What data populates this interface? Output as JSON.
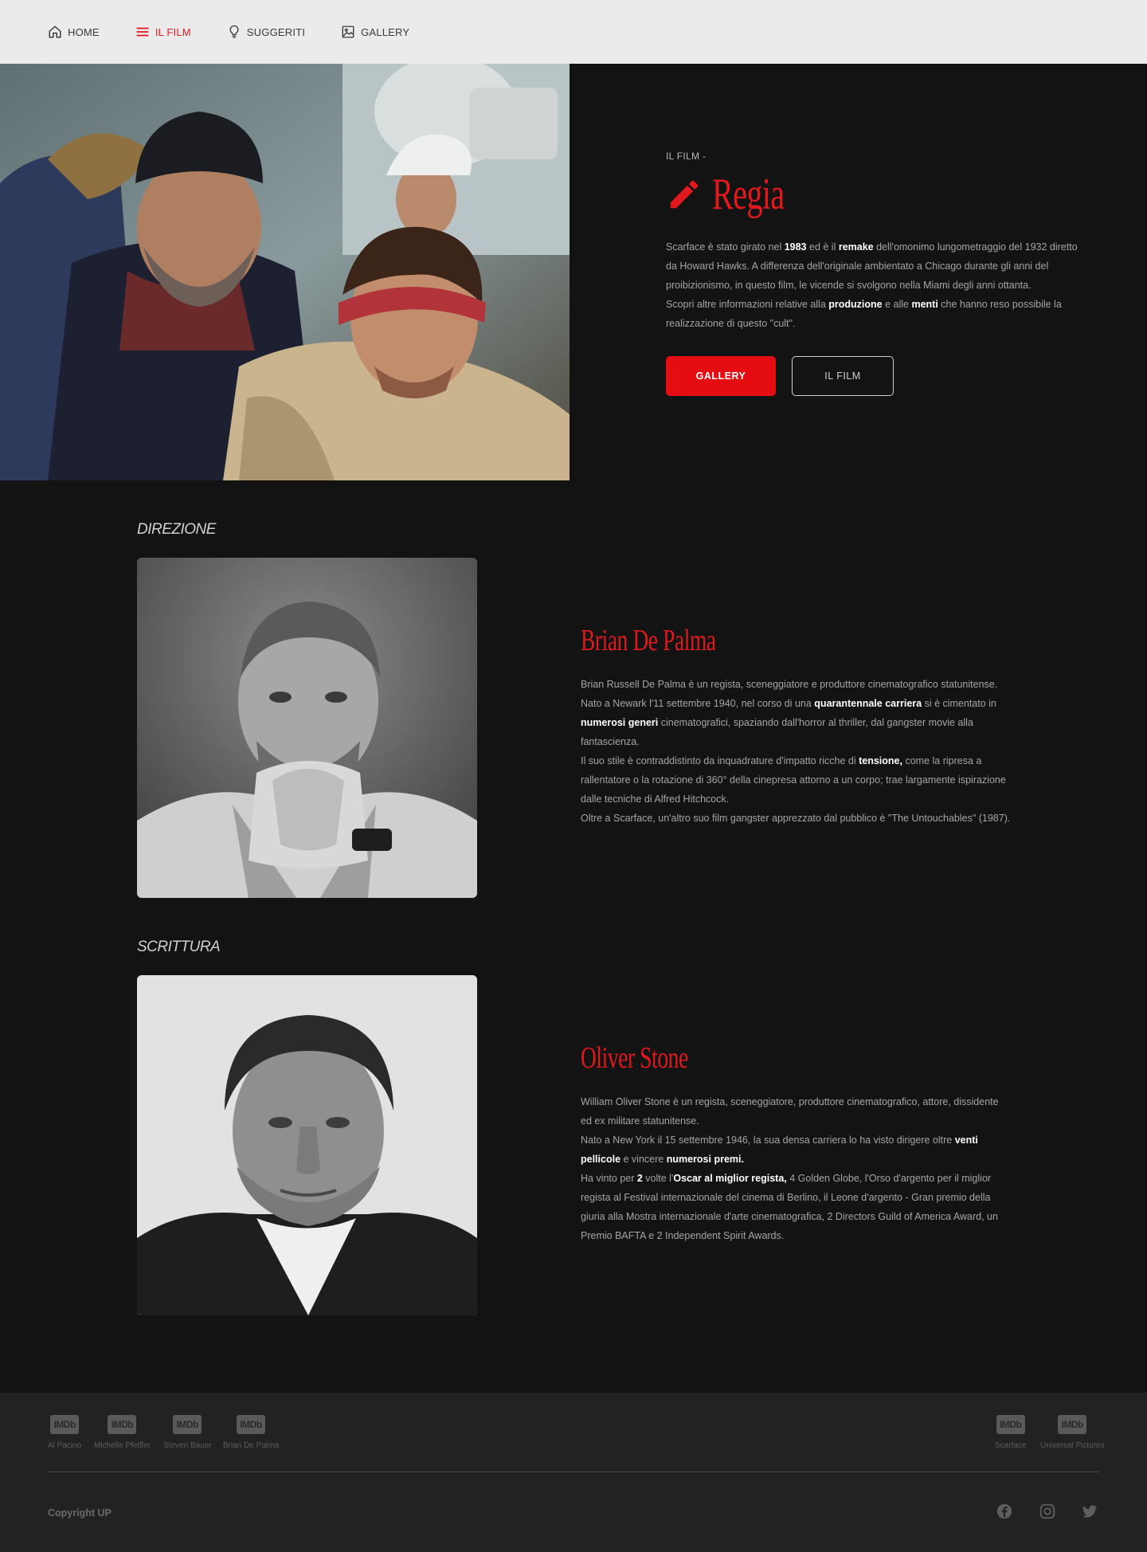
{
  "nav": {
    "items": [
      {
        "label": "HOME",
        "icon": "home-icon"
      },
      {
        "label": "IL FILM",
        "icon": "menu-icon",
        "active": true
      },
      {
        "label": "SUGGERITI",
        "icon": "lightbulb-icon"
      },
      {
        "label": "GALLERY",
        "icon": "image-icon"
      }
    ],
    "active_color": "#e0191d"
  },
  "hero": {
    "kicker": "IL FILM -",
    "title": "Regia",
    "title_icon": "pencil-icon",
    "p1": {
      "t1": "Scarface è stato girato nel ",
      "b1": "1983",
      "t2": " ed è il ",
      "b2": "remake",
      "t3": " dell'omonimo lungometraggio del 1932 diretto da Howard Hawks. A differenza dell'originale ambientato a Chicago durante gli anni del proibizionismo, in questo film, le vicende si svolgono nella Miami degli anni ottanta."
    },
    "p2": {
      "t1": "Scopri altre informazioni relative alla ",
      "b1": "produzione",
      "t2": " e alle ",
      "b2": "menti",
      "t3": " che hanno reso possibile la realizzazione di questo \"cult\"."
    },
    "btn_primary": "GALLERY",
    "btn_secondary": "IL FILM"
  },
  "direzione": {
    "label": "DIREZIONE",
    "name": "Brian De Palma",
    "p1": "Brian Russell De Palma è un regista, sceneggiatore e produttore cinematografico statunitense.",
    "p2": {
      "t1": "Nato a Newark l'11 settembre 1940, nel corso di una ",
      "b1": "quarantennale carriera",
      "t2": " si è cimentato in ",
      "b2": "numerosi generi",
      "t3": " cinematografici, spaziando dall'horror al thriller, dal gangster movie alla fantascienza."
    },
    "p3": {
      "t1": "Il suo stile è contraddistinto da inquadrature d'impatto ricche di ",
      "b1": "tensione,",
      "t2": " come la ripresa a rallentatore o la rotazione di 360° della cinepresa attorno a un corpo; trae largamente ispirazione dalle tecniche di Alfred Hitchcock."
    },
    "p4": "Oltre a Scarface, un'altro suo film gangster apprezzato dal pubblico è \"The Untouchables\" (1987)."
  },
  "scrittura": {
    "label": "SCRITTURA",
    "name": "Oliver Stone",
    "p1": "William Oliver Stone è un regista, sceneggiatore, produttore cinematografico, attore, dissidente ed ex militare statunitense.",
    "p2": {
      "t1": "Nato a New York il 15 settembre 1946, la sua densa carriera lo ha visto dirigere oltre ",
      "b1": "venti pellicole",
      "t2": " e vincere ",
      "b2": "numerosi premi."
    },
    "p3": {
      "t1": "Ha vinto per ",
      "b1": "2",
      "t2": " volte l'",
      "b2": "Oscar al miglior regista,",
      "t3": " 4 Golden Globe, l'Orso d'argento per il miglior regista al Festival internazionale del cinema di Berlino, il Leone d'argento - Gran premio della giuria alla Mostra internazionale d'arte cinematografica, 2 Directors Guild of America Award, un Premio BAFTA e 2 Independent Spirit Awards."
    }
  },
  "footer": {
    "badge_text": "IMDb",
    "imdb_left": [
      "Al Pacino",
      "Michelle Pfeiffer",
      "Steven Bauer",
      "Brian De Palma"
    ],
    "imdb_right": [
      "Scarface",
      "Universal Pictures"
    ],
    "copyright": "Copyright UP",
    "social": [
      "facebook-icon",
      "instagram-icon",
      "twitter-icon"
    ]
  }
}
